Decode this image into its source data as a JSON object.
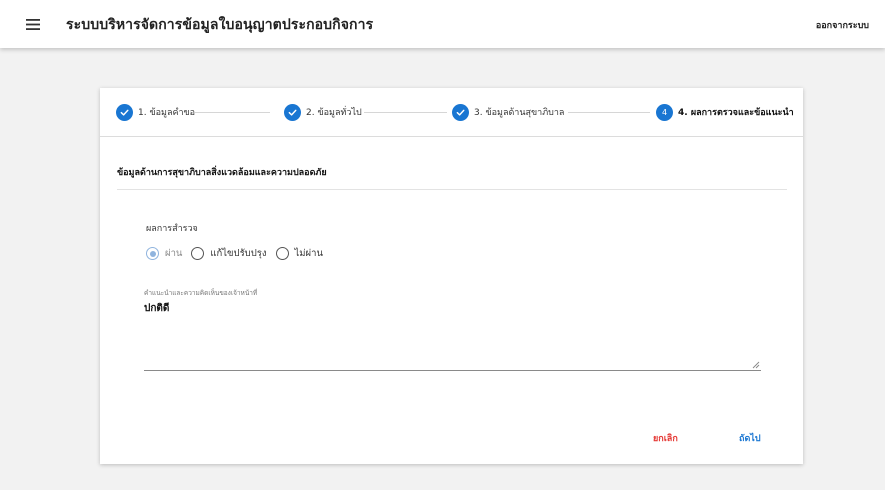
{
  "app": {
    "title": "ระบบบริหารจัดการข้อมูลใบอนุญาตประกอบกิจการ",
    "logout_label": "ออกจากระบบ"
  },
  "stepper": {
    "steps": [
      {
        "label": "1. ข้อมูลคำขอ",
        "state": "done"
      },
      {
        "label": "2. ข้อมูลทั่วไป",
        "state": "done"
      },
      {
        "label": "3. ข้อมูลด้านสุขาภิบาล",
        "state": "done"
      },
      {
        "label": "4. ผลการตรวจและข้อแนะนำ",
        "state": "active",
        "number": "4"
      }
    ]
  },
  "section": {
    "title": "ข้อมูลด้านการสุขาภิบาลสิ่งแวดล้อมและความปลอดภัย"
  },
  "result": {
    "label": "ผลการสำรวจ",
    "options": [
      {
        "label": "ผ่าน",
        "checked": true
      },
      {
        "label": "แก้ไขปรับปรุง",
        "checked": false
      },
      {
        "label": "ไม่ผ่าน",
        "checked": false
      }
    ]
  },
  "comment": {
    "label": "คำแนะนำและความคิดเห็นของเจ้าหน้าที่",
    "value": "ปกติดี"
  },
  "actions": {
    "cancel_label": "ยกเลิก",
    "next_label": "ถัดไป"
  },
  "colors": {
    "primary": "#1976d2",
    "danger": "#e53935",
    "radio_checked": "#90b4de"
  }
}
